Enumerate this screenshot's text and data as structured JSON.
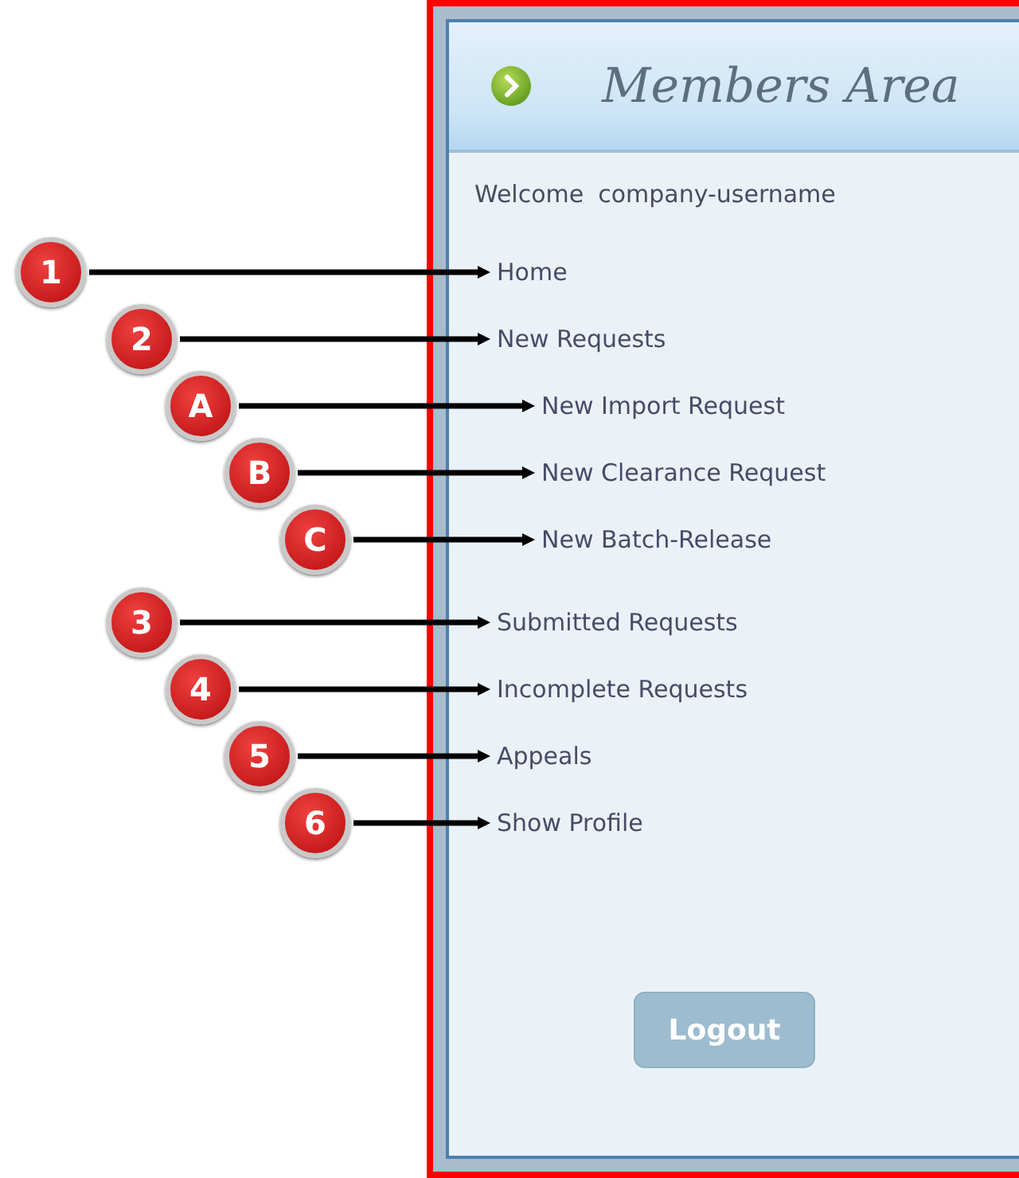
{
  "panel": {
    "title": "Members Area",
    "welcome": "Welcome",
    "username": "company-username"
  },
  "menu": [
    {
      "label": "Home",
      "callout": "1"
    },
    {
      "label": "New Requests",
      "callout": "2",
      "children": [
        {
          "label": "New Import Request",
          "callout": "A"
        },
        {
          "label": "New Clearance Request",
          "callout": "B"
        },
        {
          "label": "New Batch-Release",
          "callout": "C"
        }
      ]
    },
    {
      "label": "Submitted Requests",
      "callout": "3"
    },
    {
      "label": "Incomplete Requests",
      "callout": "4"
    },
    {
      "label": "Appeals",
      "callout": "5"
    },
    {
      "label": "Show Profile",
      "callout": "6"
    }
  ],
  "logout": "Logout"
}
